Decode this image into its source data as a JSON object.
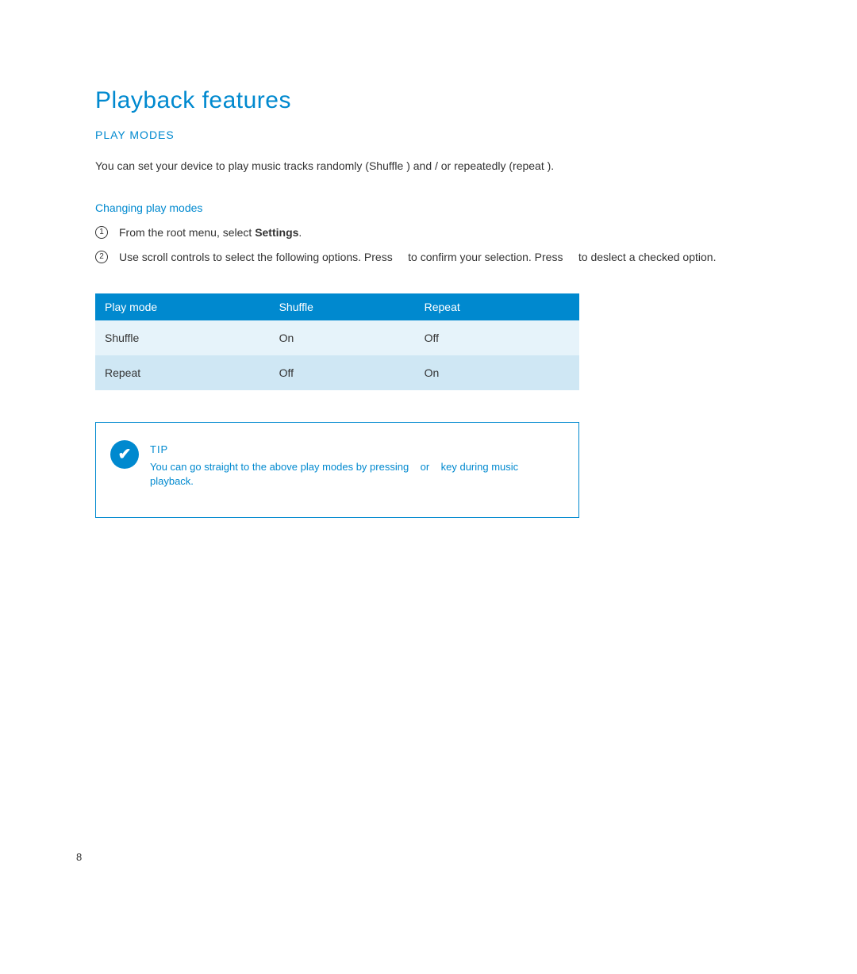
{
  "title": "Playback features",
  "section": "PLAY MODES",
  "intro": "You can set your device to play music tracks randomly (Shuffle ) and / or repeatedly (repeat ).",
  "subheading": "Changing play modes",
  "steps": {
    "s1_num": "1",
    "s1_pre": "From the root menu, select ",
    "s1_bold": "Settings",
    "s1_post": ".",
    "s2_num": "2",
    "s2_text": "Use scroll controls to select the following options. Press     to confirm your selection. Press     to deslect a checked option."
  },
  "table": {
    "h1": "Play mode",
    "h2": "Shuffle",
    "h3": "Repeat",
    "r1c1": "Shuffle",
    "r1c2": "On",
    "r1c3": "Off",
    "r2c1": "Repeat",
    "r2c2": "Off",
    "r2c3": "On"
  },
  "tip": {
    "label": "TIP",
    "text": "You can go straight to the above play modes by pressing    or    key during music playback."
  },
  "page_number": "8"
}
